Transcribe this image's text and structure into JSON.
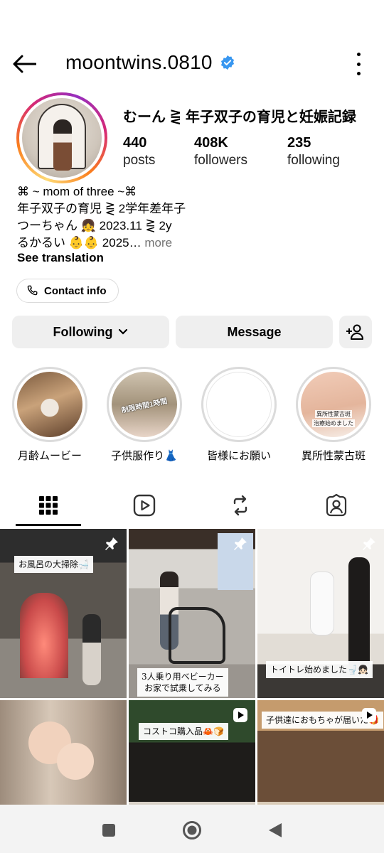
{
  "header": {
    "username": "moontwins.0810",
    "verified": true
  },
  "profile": {
    "display_name": "むーん ⋛ 年子双子の育児と妊娠記録",
    "stats": [
      {
        "value": "440",
        "label": "posts"
      },
      {
        "value": "408K",
        "label": "followers"
      },
      {
        "value": "235",
        "label": "following"
      }
    ],
    "bio_lines": [
      "⌘ ~ mom of three ~⌘",
      "年子双子の育児 ⋛ 2学年差年子",
      "つーちゃん 👧 2023.11 ⋛ 2y",
      "るかるい 👶👶 2025…"
    ],
    "bio_more": " more",
    "see_translation": "See translation",
    "contact_label": "Contact info"
  },
  "actions": {
    "following_label": "Following",
    "message_label": "Message"
  },
  "highlights": [
    {
      "label": "月齢ムービー"
    },
    {
      "label": "子供服作り👗"
    },
    {
      "label": "皆様にお願い"
    },
    {
      "label": "異所性蒙古斑"
    }
  ],
  "highlight_overlays": {
    "h2": "制限時間1時間",
    "h4_line1": "異所性蒙古斑",
    "h4_line2": "治療始めました"
  },
  "posts": [
    {
      "caption": "お風呂の大掃除🛁",
      "pinned": true
    },
    {
      "caption_line1": "3人乗り用ベビーカー",
      "caption_line2": "お家で試乗してみる",
      "pinned": true
    },
    {
      "caption": "トイトレ始めました🚽👧🏻",
      "pinned": true
    },
    {
      "caption": ""
    },
    {
      "caption": "コストコ購入品🦀🍞",
      "reel": true
    },
    {
      "caption": "子供達におもちゃが届いた🎁",
      "reel": true
    }
  ],
  "colors": {
    "verified_blue": "#3897f0",
    "button_bg": "#efefef",
    "muted_text": "#737373"
  },
  "icons": [
    "back-arrow-icon",
    "verified-badge-icon",
    "more-options-icon",
    "phone-icon",
    "chevron-down-icon",
    "add-person-icon",
    "grid-icon",
    "reels-icon",
    "reposts-icon",
    "tagged-icon",
    "pin-icon",
    "reel-icon",
    "nav-recents-icon",
    "nav-home-icon",
    "nav-back-icon"
  ]
}
